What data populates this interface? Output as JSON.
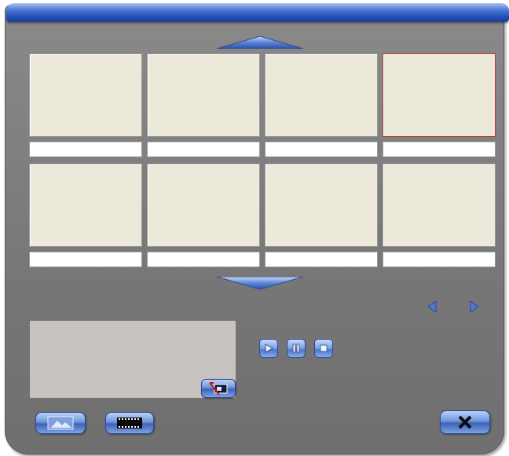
{
  "colors": {
    "title_bar": "#2751b8",
    "panel": "#7c7c7c",
    "thumb_fill": "#ece9db",
    "selected_border": "#c0392b",
    "button_blue": "#5b82d2"
  },
  "thumbnails": [
    {
      "caption": "",
      "selected": false
    },
    {
      "caption": "",
      "selected": false
    },
    {
      "caption": "",
      "selected": false
    },
    {
      "caption": "",
      "selected": true
    },
    {
      "caption": "",
      "selected": false
    },
    {
      "caption": "",
      "selected": false
    },
    {
      "caption": "",
      "selected": false
    },
    {
      "caption": "",
      "selected": false
    }
  ],
  "icons": {
    "scroll_up": "triangle-up-icon",
    "scroll_down": "triangle-down-icon",
    "prev": "arrow-left-icon",
    "next": "arrow-right-icon",
    "play": "play-icon",
    "pause": "pause-icon",
    "stop": "stop-icon",
    "remove_photo": "remove-photo-icon",
    "photo_mode": "photo-icon",
    "video_mode": "film-icon",
    "close": "close-icon"
  }
}
